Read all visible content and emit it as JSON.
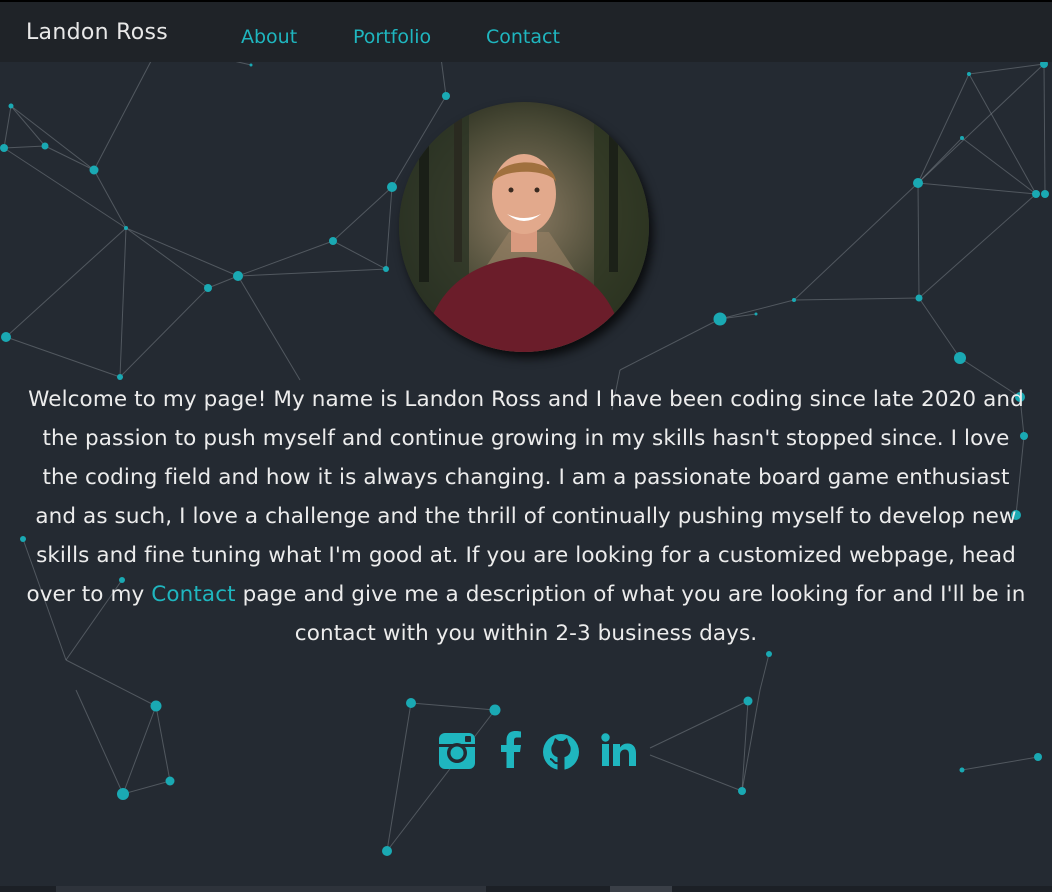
{
  "header": {
    "brand": "Landon Ross",
    "nav": [
      {
        "label": "About"
      },
      {
        "label": "Portfolio"
      },
      {
        "label": "Contact"
      }
    ]
  },
  "profile": {
    "photo_alt": "Landon Ross"
  },
  "intro": {
    "text_before_link": "Welcome to my page! My name is Landon Ross and I have been coding since late 2020 and the passion to push myself and continue growing in my skills hasn't stopped since. I love the coding field and how it is always changing. I am a passionate board game enthusiast and as such, I love a challenge and the thrill of continually pushing myself to develop new skills and fine tuning what I'm good at. If you are looking for a customized webpage, head over to my ",
    "link_label": "Contact",
    "text_after_link": " page and give me a description of what you are looking for and I'll be in contact with you within 2-3 business days."
  },
  "socials": [
    {
      "icon": "instagram-icon"
    },
    {
      "icon": "facebook-icon"
    },
    {
      "icon": "github-icon"
    },
    {
      "icon": "linkedin-icon"
    }
  ],
  "colors": {
    "accent": "#1fb6bf",
    "background": "#242a32",
    "header": "#1f2328",
    "text": "#ececec"
  }
}
